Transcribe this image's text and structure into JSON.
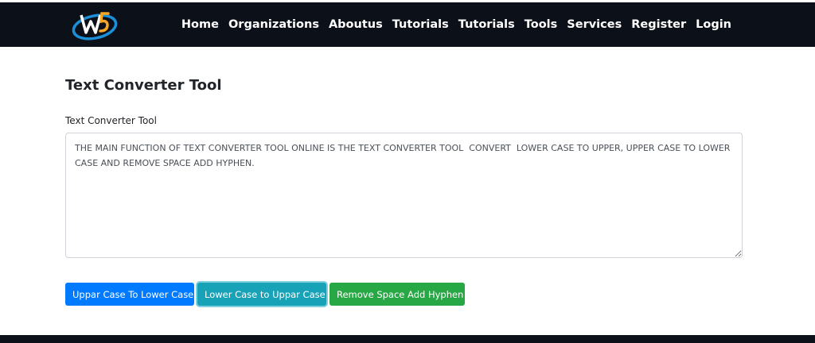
{
  "nav": {
    "items": [
      {
        "label": "Home"
      },
      {
        "label": "Organizations"
      },
      {
        "label": "Aboutus"
      },
      {
        "label": "Tutorials"
      },
      {
        "label": "Tutorials"
      },
      {
        "label": "Tools"
      },
      {
        "label": "Services"
      },
      {
        "label": "Register"
      },
      {
        "label": "Login"
      }
    ]
  },
  "page": {
    "title": "Text Converter Tool",
    "field_label": "Text Converter Tool",
    "textarea_value": "THE MAIN FUNCTION OF TEXT CONVERTER TOOL ONLINE IS THE TEXT CONVERTER TOOL  CONVERT  LOWER CASE TO UPPER, UPPER CASE TO LOWER CASE AND REMOVE SPACE ADD HYPHEN."
  },
  "buttons": {
    "to_lower": "Uppar Case To Lower Case",
    "to_upper": "Lower Case to Uppar Case",
    "hyphen": "Remove Space Add Hyphen"
  },
  "colors": {
    "navbar": "#0c1019",
    "primary": "#007bff",
    "info": "#17a2b8",
    "success": "#28a745"
  },
  "icons": {
    "logo": "wz-logo-icon"
  }
}
